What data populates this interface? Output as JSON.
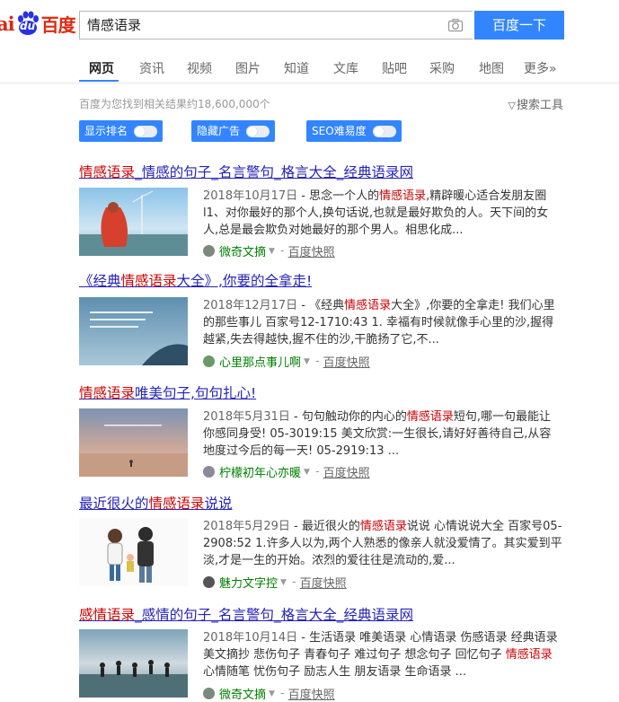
{
  "header": {
    "logo_bai": "ai",
    "logo_du": "du",
    "logo_cn": "百度",
    "query": "情感语录",
    "search_button": "百度一下"
  },
  "tabs": [
    "网页",
    "资讯",
    "视频",
    "图片",
    "知道",
    "文库",
    "贴吧",
    "采购",
    "地图",
    "更多»"
  ],
  "result_count": "百度为您找到相关结果约18,600,000个",
  "search_tools": "搜索工具",
  "toggles": [
    "显示排名",
    "隐藏广告",
    "SEO难易度"
  ],
  "results": [
    {
      "title_parts": [
        {
          "t": "情感语录",
          "em": true
        },
        {
          "t": "_情感的句子_名言警句_格言大全_经典语录网",
          "em": false
        }
      ],
      "abstract_parts": [
        {
          "t": "2018年10月17日",
          "date": true
        },
        {
          "t": " - 思念一个人的",
          "em": false
        },
        {
          "t": "情感语录",
          "em": true
        },
        {
          "t": ",精辟暖心适合发朋友圈l1、对你最好的那个人,换句话说,也就是最好欺负的人。天下间的女人,总是最会欺负对她最好的那个男人。相思化成...",
          "em": false
        }
      ],
      "source": "微奇文摘",
      "snapshot": "百度快照"
    },
    {
      "title_parts": [
        {
          "t": "《经典",
          "em": false
        },
        {
          "t": "情感语录",
          "em": true
        },
        {
          "t": "大全》,你要的全拿走!",
          "em": false
        }
      ],
      "abstract_parts": [
        {
          "t": "2018年12月17日",
          "date": true
        },
        {
          "t": " - 《经典",
          "em": false
        },
        {
          "t": "情感语录",
          "em": true
        },
        {
          "t": "大全》,你要的全拿走! 我们心里的那些事儿 百家号12-1710:43 1. 幸福有时候就像手心里的沙,握得越紧,失去得越快,握不住的沙,干脆扬了它,不...",
          "em": false
        }
      ],
      "source": "心里那点事儿啊",
      "snapshot": "百度快照"
    },
    {
      "title_parts": [
        {
          "t": "情感语录",
          "em": true
        },
        {
          "t": "唯美句子,句句扎心!",
          "em": false
        }
      ],
      "abstract_parts": [
        {
          "t": "2018年5月31日",
          "date": true
        },
        {
          "t": " - 句句触动你的内心的",
          "em": false
        },
        {
          "t": "情感语录",
          "em": true
        },
        {
          "t": "短句,哪一句最能让你感同身受! 05-3019:15 美文欣赏:一生很长,请好好善待自己,从容地度过今后的每一天! 05-2919:13 ...",
          "em": false
        }
      ],
      "source": "柠檬初年心亦暖",
      "snapshot": "百度快照"
    },
    {
      "title_parts": [
        {
          "t": "最近很火的",
          "em": false
        },
        {
          "t": "情感语录",
          "em": true
        },
        {
          "t": "说说",
          "em": false
        }
      ],
      "abstract_parts": [
        {
          "t": "2018年5月29日",
          "date": true
        },
        {
          "t": " - 最近很火的",
          "em": false
        },
        {
          "t": "情感语录",
          "em": true
        },
        {
          "t": "说说 心情说说大全 百家号05-2908:52 1.许多人以为,两个人熟悉的像亲人就没爱情了。其实爱到平淡,才是一生的开始。浓烈的爱往往是流动的,爱...",
          "em": false
        }
      ],
      "source": "魅力文字控",
      "snapshot": "百度快照"
    },
    {
      "title_parts": [
        {
          "t": "感情语录",
          "em": true
        },
        {
          "t": "_感情的句子_名言警句_格言大全_经典语录网",
          "em": false
        }
      ],
      "abstract_parts": [
        {
          "t": "2018年10月14日",
          "date": true
        },
        {
          "t": " - 生活语录 唯美语录 心情语录 伤感语录 经典语录 美文摘抄 悲伤句子 青春句子 难过句子 想念句子 回忆句子 ",
          "em": false
        },
        {
          "t": "情感语录",
          "em": true
        },
        {
          "t": " 心情随笔 忧伤句子 励志人生 朋友语录 生命语录 ...",
          "em": false
        }
      ],
      "source": "微奇文摘",
      "snapshot": "百度快照"
    }
  ]
}
